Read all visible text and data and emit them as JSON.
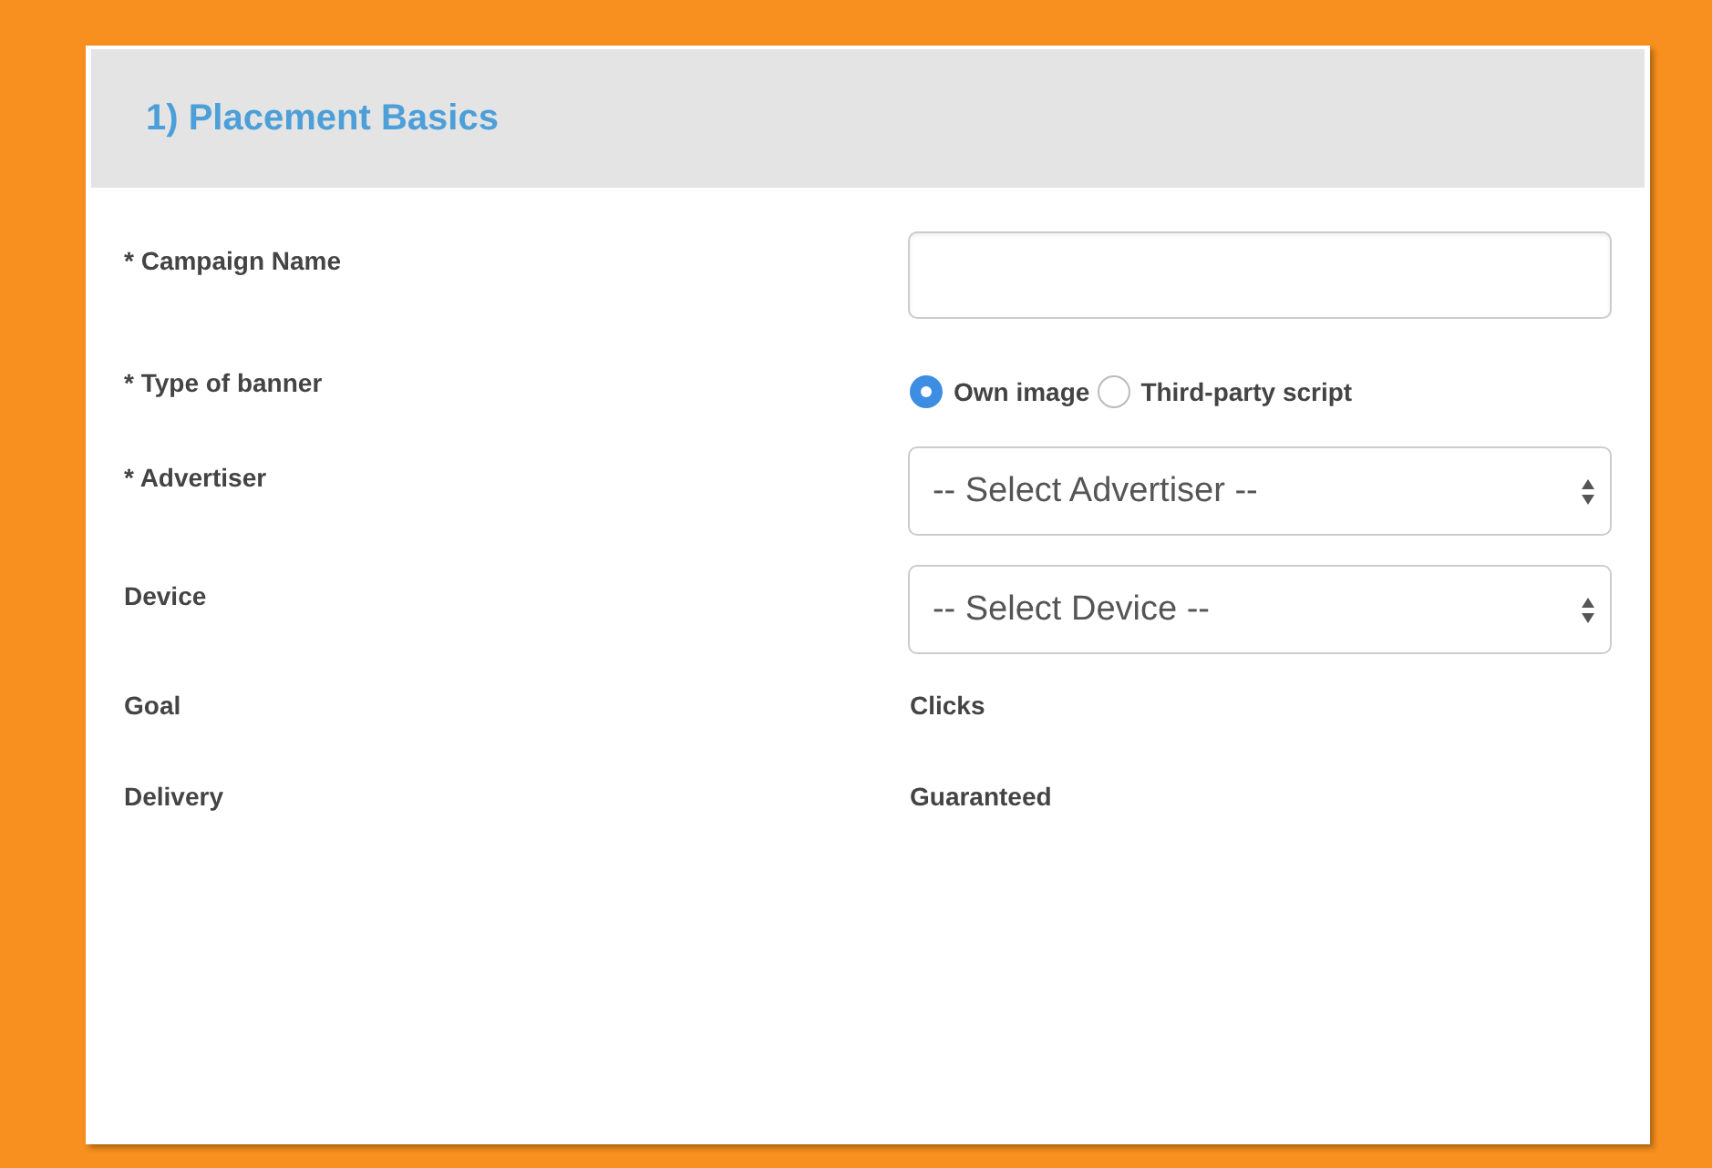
{
  "section": {
    "title": "1) Placement Basics"
  },
  "fields": [
    {
      "kind": "input",
      "label": "* Campaign Name"
    },
    {
      "kind": "radio",
      "label": "* Type of banner",
      "options": [
        {
          "label": "Own image",
          "selected": true
        },
        {
          "label": "Third-party script",
          "selected": false
        }
      ]
    },
    {
      "kind": "select",
      "label": "* Advertiser",
      "value": "-- Select Advertiser --"
    },
    {
      "kind": "select",
      "label": "Device",
      "value": "-- Select Device --"
    },
    {
      "kind": "static",
      "label": "Goal",
      "value": "Clicks"
    },
    {
      "kind": "static",
      "label": "Delivery",
      "value": "Guaranteed"
    }
  ]
}
